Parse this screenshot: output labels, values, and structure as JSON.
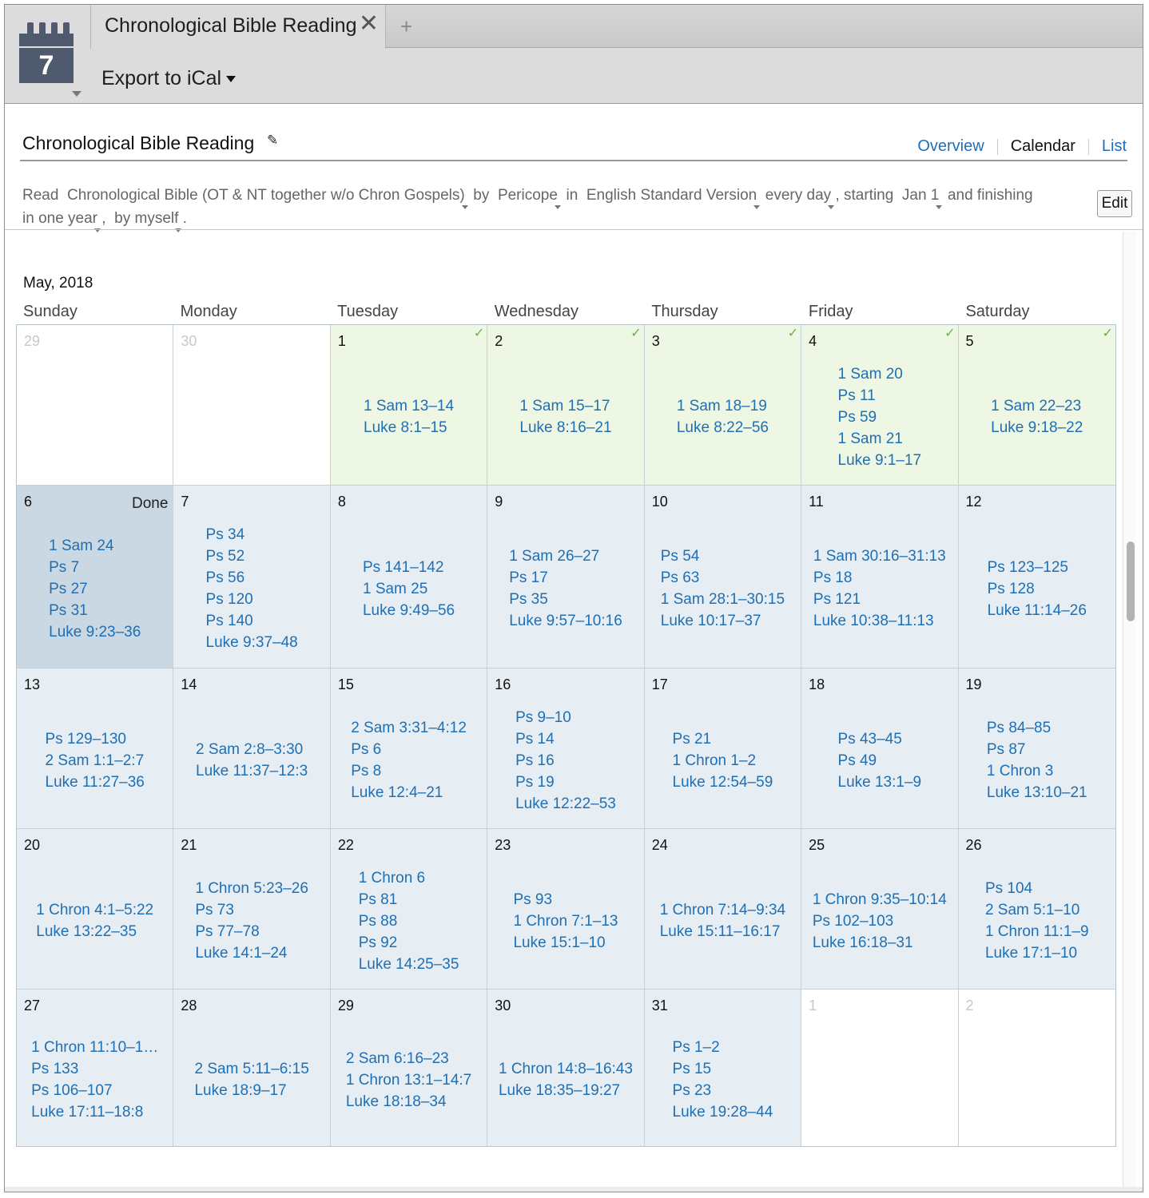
{
  "app": {
    "icon_day": "7",
    "tab_title": "Chronological Bible Reading",
    "tab_close": "✕",
    "tab_add": "+",
    "export_label": "Export to iCal"
  },
  "header": {
    "title": "Chronological Bible Reading",
    "views": {
      "overview": "Overview",
      "calendar": "Calendar",
      "list": "List"
    },
    "active_view": "Calendar"
  },
  "plan": {
    "read": "Read",
    "book": "Chronological Bible (OT & NT together w/o Chron Gospels)",
    "by": "by",
    "unit": "Pericope",
    "in": "in",
    "version": "English Standard Version",
    "frequency": "every day",
    "starting": ", starting",
    "start_date": "Jan 1",
    "and_finishing": "and finishing",
    "duration": "in one year",
    "comma": ",",
    "participants": "by myself",
    "period": ".",
    "edit_label": "Edit"
  },
  "calendar": {
    "month": "May, 2018",
    "weekdays": [
      "Sunday",
      "Monday",
      "Tuesday",
      "Wednesday",
      "Thursday",
      "Friday",
      "Saturday"
    ],
    "done_label": "Done",
    "weeks": [
      [
        {
          "day": "29",
          "status": "out",
          "readings": []
        },
        {
          "day": "30",
          "status": "out",
          "readings": []
        },
        {
          "day": "1",
          "status": "complete",
          "readings": [
            "1 Sam 13–14",
            "Luke 8:1–15"
          ]
        },
        {
          "day": "2",
          "status": "complete",
          "readings": [
            "1 Sam 15–17",
            "Luke 8:16–21"
          ]
        },
        {
          "day": "3",
          "status": "complete",
          "readings": [
            "1 Sam 18–19",
            "Luke 8:22–56"
          ]
        },
        {
          "day": "4",
          "status": "complete",
          "readings": [
            "1 Sam 20",
            "Ps 11",
            "Ps 59",
            "1 Sam 21",
            "Luke 9:1–17"
          ]
        },
        {
          "day": "5",
          "status": "complete",
          "readings": [
            "1 Sam 22–23",
            "Luke 9:18–22"
          ]
        }
      ],
      [
        {
          "day": "6",
          "status": "today",
          "readings": [
            "1 Sam 24",
            "Ps 7",
            "Ps 27",
            "Ps 31",
            "Luke 9:23–36"
          ]
        },
        {
          "day": "7",
          "status": "upcoming",
          "readings": [
            "Ps 34",
            "Ps 52",
            "Ps 56",
            "Ps 120",
            "Ps 140",
            "Luke 9:37–48"
          ]
        },
        {
          "day": "8",
          "status": "upcoming",
          "readings": [
            "Ps 141–142",
            "1 Sam 25",
            "Luke 9:49–56"
          ]
        },
        {
          "day": "9",
          "status": "upcoming",
          "readings": [
            "1 Sam 26–27",
            "Ps 17",
            "Ps 35",
            "Luke 9:57–10:16"
          ]
        },
        {
          "day": "10",
          "status": "upcoming",
          "readings": [
            "Ps 54",
            "Ps 63",
            "1 Sam 28:1–30:15",
            "Luke 10:17–37"
          ]
        },
        {
          "day": "11",
          "status": "upcoming",
          "readings": [
            "1 Sam 30:16–31:13",
            "Ps 18",
            "Ps 121",
            "Luke 10:38–11:13"
          ]
        },
        {
          "day": "12",
          "status": "upcoming",
          "readings": [
            "Ps 123–125",
            "Ps 128",
            "Luke 11:14–26"
          ]
        }
      ],
      [
        {
          "day": "13",
          "status": "upcoming",
          "readings": [
            "Ps 129–130",
            "2 Sam 1:1–2:7",
            "Luke 11:27–36"
          ]
        },
        {
          "day": "14",
          "status": "upcoming",
          "readings": [
            "2 Sam 2:8–3:30",
            "Luke 11:37–12:3"
          ]
        },
        {
          "day": "15",
          "status": "upcoming",
          "readings": [
            "2 Sam 3:31–4:12",
            "Ps 6",
            "Ps 8",
            "Luke 12:4–21"
          ]
        },
        {
          "day": "16",
          "status": "upcoming",
          "readings": [
            "Ps 9–10",
            "Ps 14",
            "Ps 16",
            "Ps 19",
            "Luke 12:22–53"
          ]
        },
        {
          "day": "17",
          "status": "upcoming",
          "readings": [
            "Ps 21",
            "1 Chron 1–2",
            "Luke 12:54–59"
          ]
        },
        {
          "day": "18",
          "status": "upcoming",
          "readings": [
            "Ps 43–45",
            "Ps 49",
            "Luke 13:1–9"
          ]
        },
        {
          "day": "19",
          "status": "upcoming",
          "readings": [
            "Ps 84–85",
            "Ps 87",
            "1 Chron 3",
            "Luke 13:10–21"
          ]
        }
      ],
      [
        {
          "day": "20",
          "status": "upcoming",
          "readings": [
            "1 Chron 4:1–5:22",
            "Luke 13:22–35"
          ]
        },
        {
          "day": "21",
          "status": "upcoming",
          "readings": [
            "1 Chron 5:23–26",
            "Ps 73",
            "Ps 77–78",
            "Luke 14:1–24"
          ]
        },
        {
          "day": "22",
          "status": "upcoming",
          "readings": [
            "1 Chron 6",
            "Ps 81",
            "Ps 88",
            "Ps 92",
            "Luke 14:25–35"
          ]
        },
        {
          "day": "23",
          "status": "upcoming",
          "readings": [
            "Ps 93",
            "1 Chron 7:1–13",
            "Luke 15:1–10"
          ]
        },
        {
          "day": "24",
          "status": "upcoming",
          "readings": [
            "1 Chron 7:14–9:34",
            "Luke 15:11–16:17"
          ]
        },
        {
          "day": "25",
          "status": "upcoming",
          "readings": [
            "1 Chron 9:35–10:14",
            "Ps 102–103",
            "Luke 16:18–31"
          ]
        },
        {
          "day": "26",
          "status": "upcoming",
          "readings": [
            "Ps 104",
            "2 Sam 5:1–10",
            "1 Chron 11:1–9",
            "Luke 17:1–10"
          ]
        }
      ],
      [
        {
          "day": "27",
          "status": "upcoming",
          "readings": [
            "1 Chron 11:10–1…",
            "Ps 133",
            "Ps 106–107",
            "Luke 17:11–18:8"
          ]
        },
        {
          "day": "28",
          "status": "upcoming",
          "readings": [
            "2 Sam 5:11–6:15",
            "Luke 18:9–17"
          ]
        },
        {
          "day": "29",
          "status": "upcoming",
          "readings": [
            "2 Sam 6:16–23",
            "1 Chron 13:1–14:7",
            "Luke 18:18–34"
          ]
        },
        {
          "day": "30",
          "status": "upcoming",
          "readings": [
            "1 Chron 14:8–16:43",
            "Luke 18:35–19:27"
          ]
        },
        {
          "day": "31",
          "status": "upcoming",
          "readings": [
            "Ps 1–2",
            "Ps 15",
            "Ps 23",
            "Luke 19:28–44"
          ]
        },
        {
          "day": "1",
          "status": "out",
          "readings": []
        },
        {
          "day": "2",
          "status": "out",
          "readings": []
        }
      ]
    ]
  },
  "icons": {
    "app": "calendar-icon",
    "close": "close-icon",
    "edit": "pencil-icon",
    "check": "checkmark-icon"
  },
  "colors": {
    "link": "#1f6fb5",
    "complete_bg": "#edf7e3",
    "upcoming_bg": "#e6eef3",
    "today_bg": "#c9d8e2",
    "check": "#6ab04c"
  }
}
